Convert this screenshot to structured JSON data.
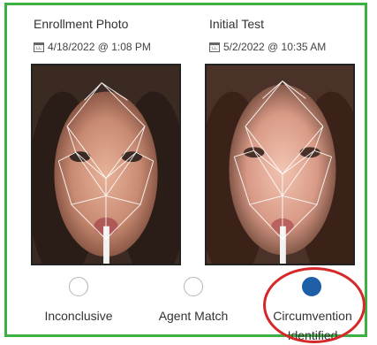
{
  "enrollment": {
    "title": "Enrollment Photo",
    "date": "4/18/2022 @ 1:08 PM"
  },
  "initial_test": {
    "title": "Initial Test",
    "date": "5/2/2022 @ 10:35 AM"
  },
  "options": [
    {
      "label": "Inconclusive",
      "selected": false
    },
    {
      "label": "Agent Match",
      "selected": false
    },
    {
      "label_line1": "Circumvention",
      "label_line2": "Identified",
      "selected": true
    }
  ],
  "colors": {
    "frame_border": "#3cb043",
    "selected_radio": "#1f5fa8",
    "highlight": "#d62828"
  },
  "icons": {
    "date_icon": "calendar-icon"
  }
}
